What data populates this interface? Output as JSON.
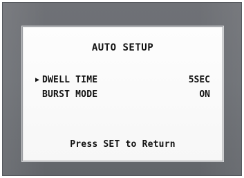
{
  "screen": {
    "title": "AUTO SETUP",
    "items": [
      {
        "label": "DWELL TIME",
        "value": "5SEC",
        "selected": true
      },
      {
        "label": "BURST MODE",
        "value": "ON",
        "selected": false
      }
    ],
    "cursor_icon": "triangle-right-icon",
    "footer": "Press SET to Return"
  }
}
